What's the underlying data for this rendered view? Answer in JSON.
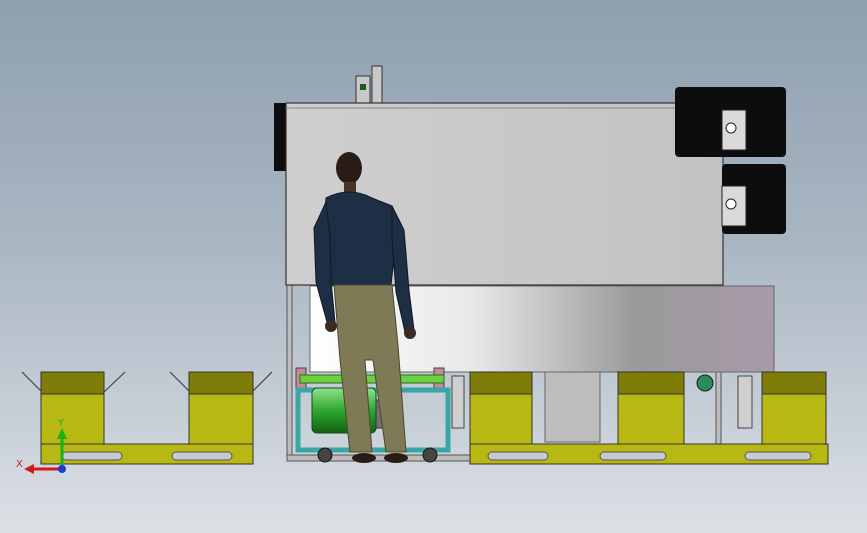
{
  "viewport": {
    "kind": "cad-3d-viewport",
    "background_top": "#8f9fb0",
    "background_bottom": "#dde1e6"
  },
  "triad": {
    "x_label": "X",
    "y_label": "Y",
    "x_color": "#d11a1a",
    "y_color": "#19b319",
    "z_color": "#1a3bd1"
  },
  "colors": {
    "cabinet_gray": "#c9c9c9",
    "drum_silver": "#d6d6d6",
    "crate_olive": "#b8b812",
    "crate_top": "#7d7d08",
    "motor_green": "#2ea82e",
    "cart_teal": "#3aa6a6",
    "panel_black": "#0d0d0d",
    "jacket_navy": "#1e2f45",
    "pants_khaki": "#7d7a55"
  },
  "model_parts": [
    "roof-box",
    "left-crate",
    "inspector-figure",
    "control-box-upper",
    "control-box-lower",
    "green-motor-cart",
    "drum-tank",
    "right-crate-row"
  ]
}
